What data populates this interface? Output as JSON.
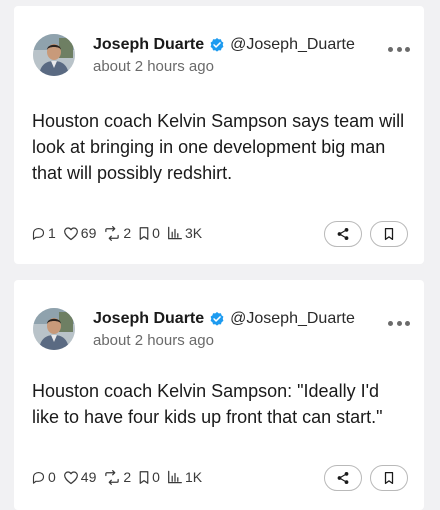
{
  "posts": [
    {
      "author": "Joseph Duarte",
      "handle": "@Joseph_Duarte",
      "time": "about 2 hours ago",
      "text": "Houston coach Kelvin Sampson says team will look at bringing in one development big man that will possibly redshirt.",
      "stats": {
        "replies": "1",
        "likes": "69",
        "reposts": "2",
        "bookmarks": "0",
        "views": "3K"
      }
    },
    {
      "author": "Joseph Duarte",
      "handle": "@Joseph_Duarte",
      "time": "about 2 hours ago",
      "text": "Houston coach Kelvin Sampson: \"Ideally I'd like to have four kids up front that can start.\"",
      "stats": {
        "replies": "0",
        "likes": "49",
        "reposts": "2",
        "bookmarks": "0",
        "views": "1K"
      }
    }
  ],
  "colors": {
    "verified": "#1d9bf0",
    "page_background": "#f1f1f3",
    "card_background": "#ffffff"
  },
  "icons": [
    "verified-badge-icon",
    "more-icon",
    "reply-icon",
    "like-icon",
    "repost-icon",
    "bookmark-icon",
    "views-icon",
    "share-icon"
  ]
}
